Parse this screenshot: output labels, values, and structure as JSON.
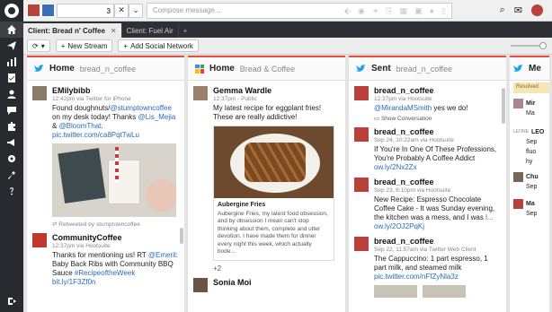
{
  "topbar": {
    "selected_count": "3",
    "compose_placeholder": "Compose message..."
  },
  "tabs": [
    {
      "label": "Client: Bread n' Coffee"
    },
    {
      "label": "Client: Fuel Air"
    }
  ],
  "toolbar": {
    "new_stream": "New Stream",
    "add_network": "Add Social Network"
  },
  "columns": [
    {
      "title": "Home",
      "handle": "bread_n_coffee",
      "messages": [
        {
          "name": "EMilybibb",
          "meta": "12:42pm via Twitter for iPhone",
          "text1": "Found doughnuts/",
          "link1": "@stumptowncoffee",
          "text2": " on my desk today! Thanks ",
          "link2": "@Lis_Mejia",
          "text3": " & ",
          "link3": "@BloomThat",
          "text4": ".",
          "link4": "pic.twitter.com/ca8PqtTwLu",
          "retweet": "Retweeted by stumptowncoffee"
        },
        {
          "name": "CommunityCoffee",
          "meta": "12:37pm via Hootsuite",
          "text1": "Thanks for mentioning us! RT ",
          "link1": "@Emeril",
          "text2": ": Baby Back Ribs with Community BBQ Sauce ",
          "link2": "#RecipeoftheWeek",
          "text3": " ",
          "link3": "bit.ly/1F3Zf0n"
        }
      ]
    },
    {
      "title": "Home",
      "handle": "Bread & Coffee",
      "messages": [
        {
          "name": "Gemma Wardle",
          "meta": "12:37pm - Public",
          "text": "My latest recipe for eggplant fries! These are really addictive!",
          "card_title": "Aubergine Fries",
          "card_text": "Aubergine Fries, my latest food obsession, and by obsession I mean can't stop thinking about them, complete and utter devotion. I have made them for dinner every night this week, which actually bode...",
          "plus": "+2"
        },
        {
          "name": "Sonia Moi"
        }
      ]
    },
    {
      "title": "Sent",
      "handle": "bread_n_coffee",
      "messages": [
        {
          "name": "bread_n_coffee",
          "meta": "12:37pm via Hootsuite",
          "link1": "@MirandaMSmith",
          "text1": " yes we do!",
          "conv": "Show Conversation"
        },
        {
          "name": "bread_n_coffee",
          "meta": "Sep 24, 10:22am via Hootsuite",
          "text1": "If You're In One Of These Professions, You're Probably A Coffee Addict ",
          "link1": "ow.ly/2Nx2Zx"
        },
        {
          "name": "bread_n_coffee",
          "meta": "Sep 23, 6:10pm via Hootsuite",
          "text1": "New Recipe: Espresso Chocolate Coffee Cake - It was Sunday evening, the kitchen was a mess, and I was ",
          "link1": "l...",
          "text2": " ",
          "link2": "ow.ly/2OJ2PqKj"
        },
        {
          "name": "bread_n_coffee",
          "meta": "Sep 22, 11:57am via Twitter Web Client",
          "text1": "The Cappuccino: 1 part espresso, 1 part milk, and steamed milk ",
          "link1": "pic.twitter.com/nFfZyNla3z"
        }
      ]
    },
    {
      "title": "Me",
      "resolved": "Resolved",
      "items": [
        "Mir",
        "Ma",
        "LEO",
        "Sep",
        "fluo",
        "hy",
        "Chu",
        "Sep",
        "Ma",
        "Sep"
      ]
    }
  ],
  "colors": {
    "accent": "#e84c3d",
    "twitter": "#1da1f2",
    "sidebar": "#272a2e",
    "link": "#2a6bb3"
  }
}
